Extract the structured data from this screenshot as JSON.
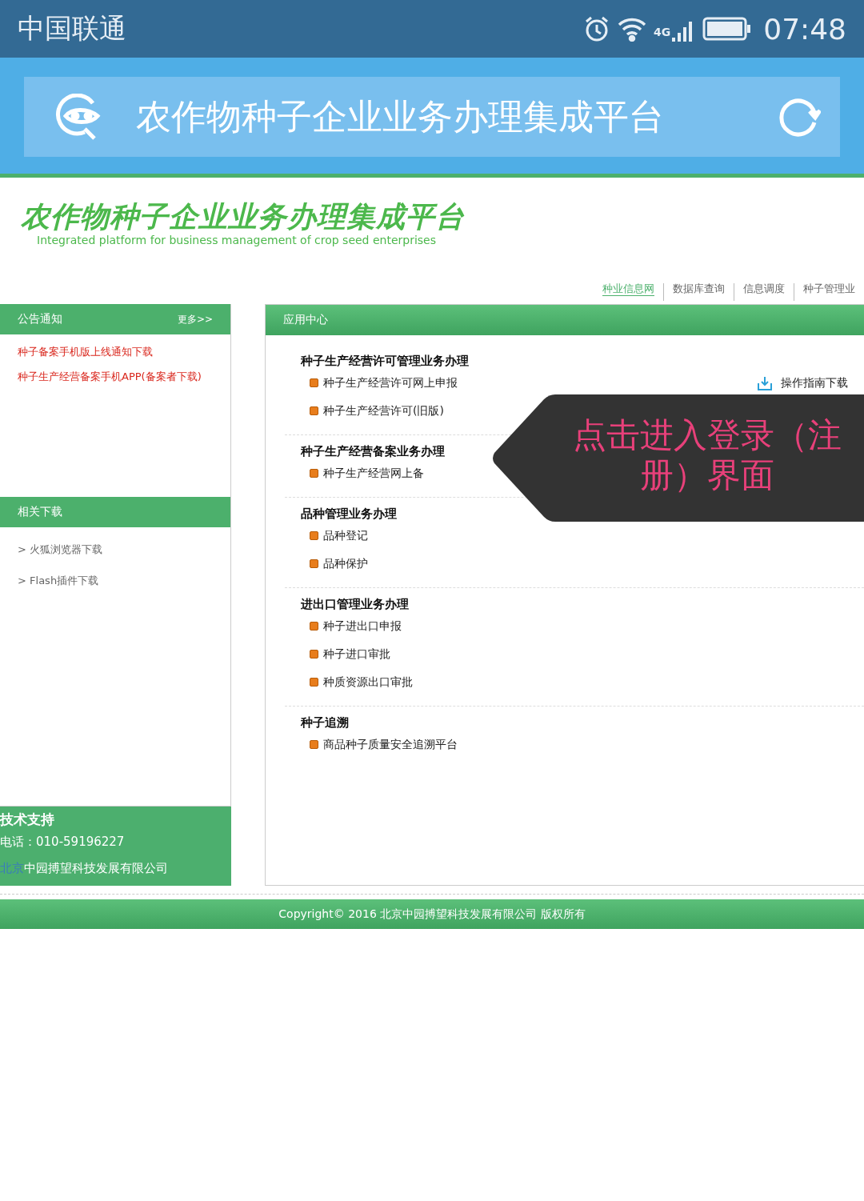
{
  "status_bar": {
    "carrier": "中国联通",
    "network": "4G",
    "time": "07:48"
  },
  "app_bar": {
    "title": "农作物种子企业业务办理集成平台"
  },
  "header": {
    "logo_title": "农作物种子企业业务办理集成平台",
    "logo_subtitle": "Integrated platform for business management of crop seed enterprises"
  },
  "nav": [
    {
      "label": "种业信息网",
      "selected": true
    },
    {
      "label": "数据库查询",
      "selected": false
    },
    {
      "label": "信息调度",
      "selected": false
    },
    {
      "label": "种子管理业",
      "selected": false
    }
  ],
  "notices": {
    "title": "公告通知",
    "more": "更多>>",
    "items": [
      "种子备案手机版上线通知下载",
      "种子生产经营备案手机APP(备案者下载)"
    ]
  },
  "downloads": {
    "title": "相关下载",
    "items": [
      {
        "marker": ">",
        "label": "火狐浏览器下载"
      },
      {
        "marker": ">",
        "label": "Flash插件下载"
      }
    ]
  },
  "support": {
    "title": "技术支持",
    "phone": "电话：010-59196227",
    "company_prefix": "北京",
    "company": "中园搏望科技发展有限公司"
  },
  "app_center": {
    "title": "应用中心",
    "sections": [
      {
        "title": "种子生产经营许可管理业务办理",
        "items": [
          {
            "label": "种子生产经营许可网上申报",
            "guide": "操作指南下载"
          },
          {
            "label": "种子生产经营许可(旧版)"
          }
        ]
      },
      {
        "title": "种子生产经营备案业务办理",
        "items": [
          {
            "label": "种子生产经营网上备"
          }
        ]
      },
      {
        "title": "品种管理业务办理",
        "items": [
          {
            "label": "品种登记"
          },
          {
            "label": "品种保护"
          }
        ]
      },
      {
        "title": "进出口管理业务办理",
        "items": [
          {
            "label": "种子进出口申报"
          },
          {
            "label": "种子进口审批"
          },
          {
            "label": "种质资源出口审批"
          }
        ]
      },
      {
        "title": "种子追溯",
        "items": [
          {
            "label": "商品种子质量安全追溯平台"
          }
        ]
      }
    ]
  },
  "footer": {
    "copyright": "Copyright© 2016 北京中园搏望科技发展有限公司 版权所有"
  },
  "tooltip": {
    "text": "点击进入登录（注册）界面"
  }
}
